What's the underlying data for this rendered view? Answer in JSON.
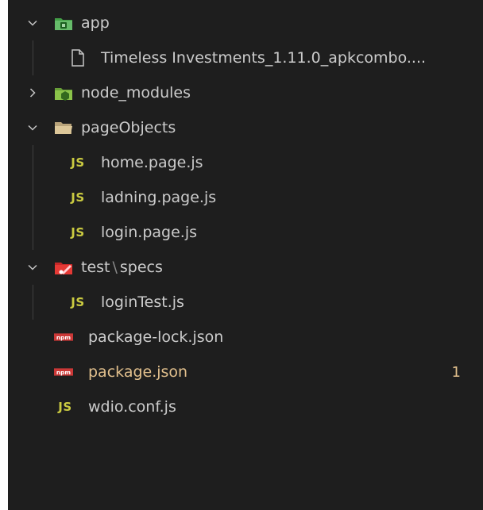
{
  "explorer": {
    "app_folder": {
      "label": "app"
    },
    "apk_file": {
      "label": "Timeless Investments_1.11.0_apkcombo...."
    },
    "node_modules_folder": {
      "label": "node_modules"
    },
    "pageobjects_folder": {
      "label": "pageObjects"
    },
    "home_page_file": {
      "label": "home.page.js"
    },
    "ladning_page_file": {
      "label": "ladning.page.js"
    },
    "login_page_file": {
      "label": "login.page.js"
    },
    "test_folder": {
      "label_a": "test",
      "separator": "\\",
      "label_b": "specs"
    },
    "logintest_file": {
      "label": "loginTest.js"
    },
    "package_lock_file": {
      "label": "package-lock.json"
    },
    "package_file": {
      "label": "package.json",
      "badge": "1"
    },
    "wdio_file": {
      "label": "wdio.conf.js"
    },
    "js_icon_text": "JS",
    "npm_icon_text": "npm"
  },
  "colors": {
    "background": "#1e1e1e",
    "text": "#cccccc",
    "modified": "#e2c08d",
    "js_yellow": "#cbcb41",
    "npm_red": "#cb3837",
    "app_folder_green": "#4caf50",
    "node_modules_green": "#8bc34a",
    "test_folder_red": "#e53935"
  }
}
